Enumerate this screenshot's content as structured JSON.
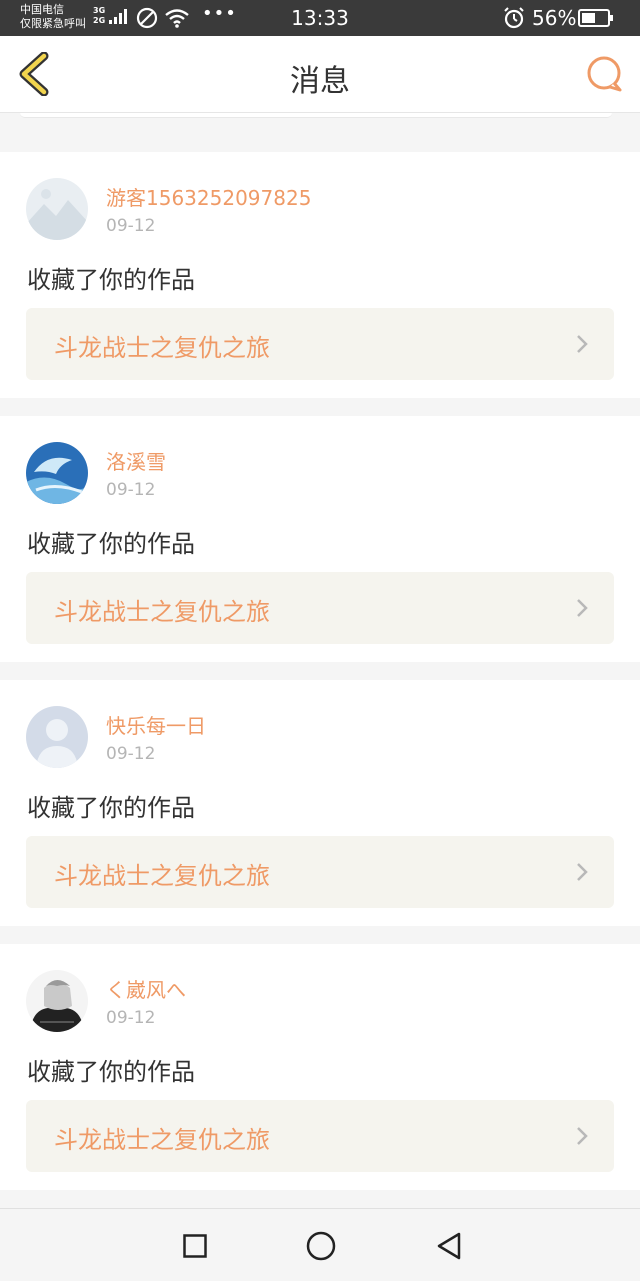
{
  "status_bar": {
    "carrier_line1": "中国电信",
    "carrier_line2": "仅限紧急呼叫",
    "net1": "3G",
    "net2": "2G",
    "more": "•••",
    "time": "13:33",
    "battery": "56%",
    "battery_level": 0.56
  },
  "header": {
    "title": "消息",
    "back_icon": "chevron-left-icon",
    "chat_icon": "chat-bubble-icon",
    "accent": "#ef9a66"
  },
  "messages": [
    {
      "user": "游客1563252097825",
      "date": "09-12",
      "action": "收藏了你的作品",
      "work": "斗龙战士之复仇之旅",
      "avatar": "avatar-mountain-placeholder"
    },
    {
      "user": "洛溪雪",
      "date": "09-12",
      "action": "收藏了你的作品",
      "work": "斗龙战士之复仇之旅",
      "avatar": "avatar-blue-dolphin"
    },
    {
      "user": "快乐每一日",
      "date": "09-12",
      "action": "收藏了你的作品",
      "work": "斗龙战士之复仇之旅",
      "avatar": "avatar-default-person"
    },
    {
      "user": "く崴风へ",
      "date": "09-12",
      "action": "收藏了你的作品",
      "work": "斗龙战士之复仇之旅",
      "avatar": "avatar-anime-character"
    }
  ],
  "nav": {
    "recent_icon": "square-icon",
    "home_icon": "circle-icon",
    "back_icon": "triangle-back-icon"
  }
}
